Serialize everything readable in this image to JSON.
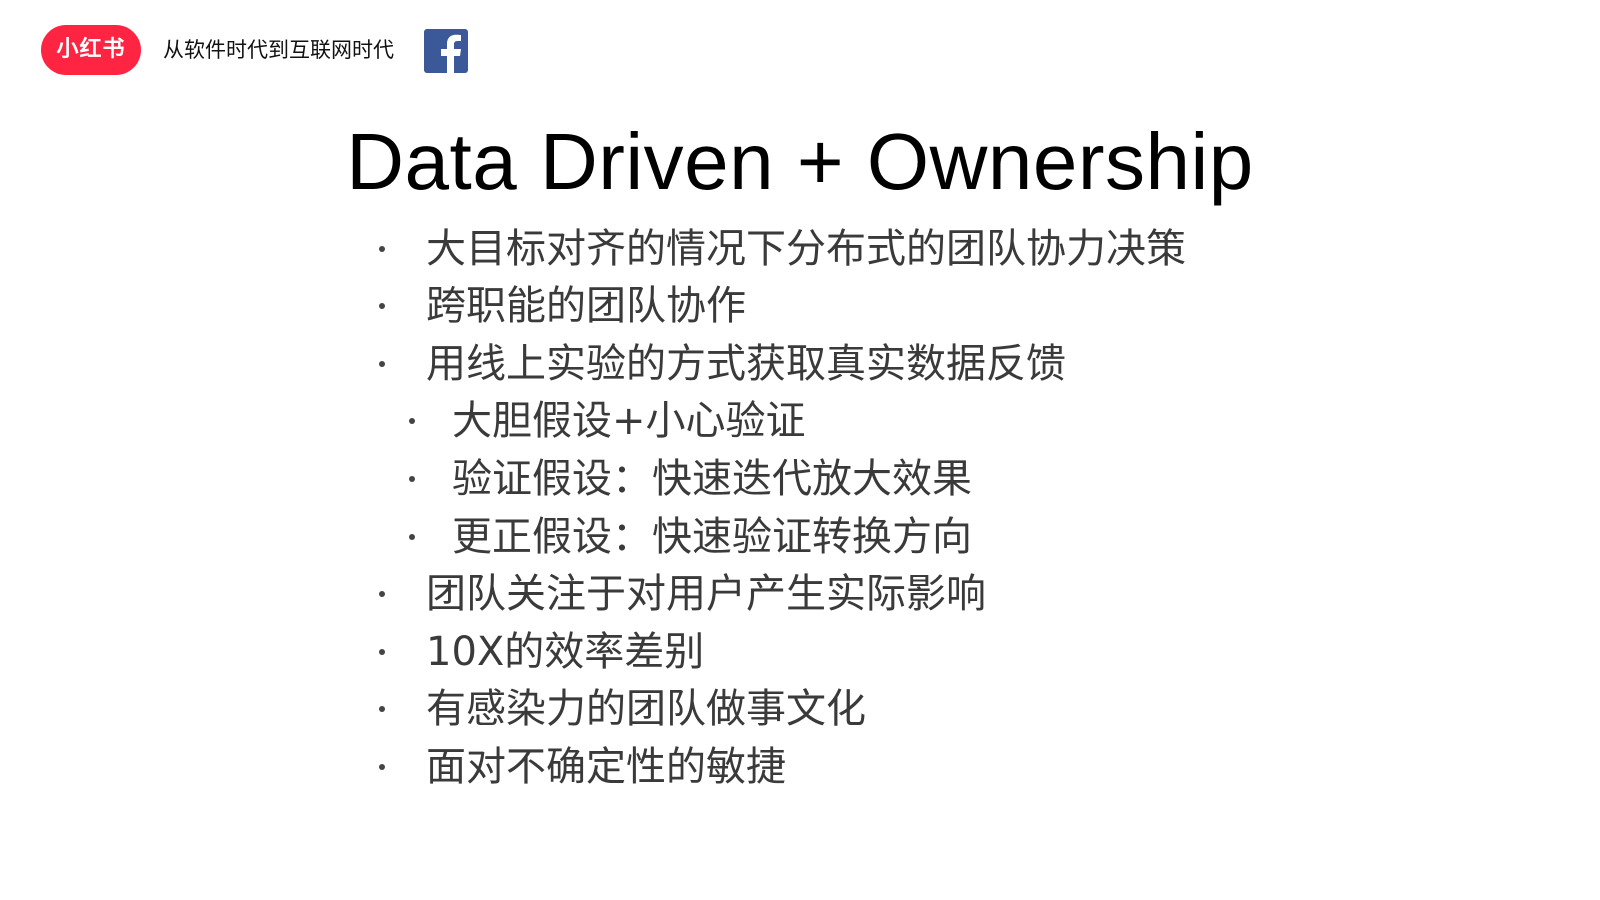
{
  "header": {
    "logo_text": "小红书",
    "subtitle": "从软件时代到互联网时代",
    "brand_color": "#ff2442",
    "facebook_icon": "facebook-icon",
    "facebook_color": "#3b5998"
  },
  "slide": {
    "title": "Data Driven + Ownership",
    "bullets": [
      {
        "text": "大目标对齐的情况下分布式的团队协力决策",
        "level": 1
      },
      {
        "text": "跨职能的团队协作",
        "level": 1
      },
      {
        "text": "用线上实验的方式获取真实数据反馈",
        "level": 1
      },
      {
        "text": "大胆假设+小心验证",
        "level": 2
      },
      {
        "text": "验证假设：快速迭代放大效果",
        "level": 2
      },
      {
        "text": "更正假设：快速验证转换方向",
        "level": 2
      },
      {
        "text": "团队关注于对用户产生实际影响",
        "level": 1
      },
      {
        "text": "10X的效率差别",
        "level": 1
      },
      {
        "text": "有感染力的团队做事文化",
        "level": 1
      },
      {
        "text": "面对不确定性的敏捷",
        "level": 1
      }
    ]
  }
}
